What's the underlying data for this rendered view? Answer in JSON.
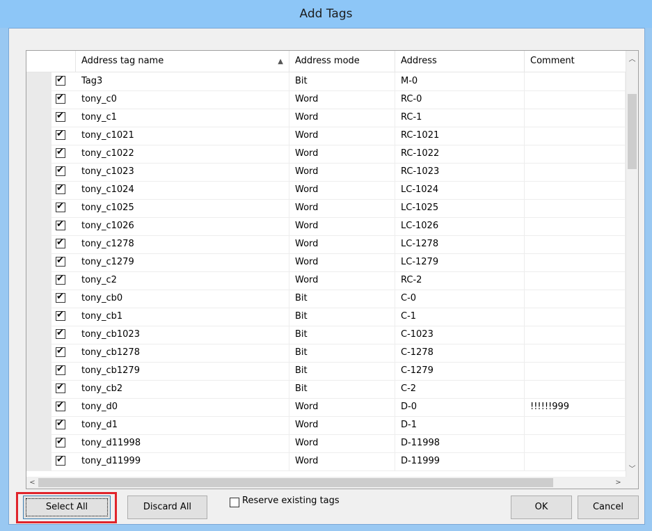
{
  "window": {
    "title": "Add Tags"
  },
  "table": {
    "columns": [
      "Address tag name",
      "Address mode",
      "Address",
      "Comment"
    ],
    "rows": [
      {
        "checked": true,
        "name": "Tag3",
        "mode": "Bit",
        "address": "M-0",
        "comment": ""
      },
      {
        "checked": true,
        "name": "tony_c0",
        "mode": "Word",
        "address": "RC-0",
        "comment": ""
      },
      {
        "checked": true,
        "name": "tony_c1",
        "mode": "Word",
        "address": "RC-1",
        "comment": ""
      },
      {
        "checked": true,
        "name": "tony_c1021",
        "mode": "Word",
        "address": "RC-1021",
        "comment": ""
      },
      {
        "checked": true,
        "name": "tony_c1022",
        "mode": "Word",
        "address": "RC-1022",
        "comment": ""
      },
      {
        "checked": true,
        "name": "tony_c1023",
        "mode": "Word",
        "address": "RC-1023",
        "comment": ""
      },
      {
        "checked": true,
        "name": "tony_c1024",
        "mode": "Word",
        "address": "LC-1024",
        "comment": ""
      },
      {
        "checked": true,
        "name": "tony_c1025",
        "mode": "Word",
        "address": "LC-1025",
        "comment": ""
      },
      {
        "checked": true,
        "name": "tony_c1026",
        "mode": "Word",
        "address": "LC-1026",
        "comment": ""
      },
      {
        "checked": true,
        "name": "tony_c1278",
        "mode": "Word",
        "address": "LC-1278",
        "comment": ""
      },
      {
        "checked": true,
        "name": "tony_c1279",
        "mode": "Word",
        "address": "LC-1279",
        "comment": ""
      },
      {
        "checked": true,
        "name": "tony_c2",
        "mode": "Word",
        "address": "RC-2",
        "comment": ""
      },
      {
        "checked": true,
        "name": "tony_cb0",
        "mode": "Bit",
        "address": "C-0",
        "comment": ""
      },
      {
        "checked": true,
        "name": "tony_cb1",
        "mode": "Bit",
        "address": "C-1",
        "comment": ""
      },
      {
        "checked": true,
        "name": "tony_cb1023",
        "mode": "Bit",
        "address": "C-1023",
        "comment": ""
      },
      {
        "checked": true,
        "name": "tony_cb1278",
        "mode": "Bit",
        "address": "C-1278",
        "comment": ""
      },
      {
        "checked": true,
        "name": "tony_cb1279",
        "mode": "Bit",
        "address": "C-1279",
        "comment": ""
      },
      {
        "checked": true,
        "name": "tony_cb2",
        "mode": "Bit",
        "address": "C-2",
        "comment": ""
      },
      {
        "checked": true,
        "name": "tony_d0",
        "mode": "Word",
        "address": "D-0",
        "comment": "!!!!!!999"
      },
      {
        "checked": true,
        "name": "tony_d1",
        "mode": "Word",
        "address": "D-1",
        "comment": ""
      },
      {
        "checked": true,
        "name": "tony_d11998",
        "mode": "Word",
        "address": "D-11998",
        "comment": ""
      },
      {
        "checked": true,
        "name": "tony_d11999",
        "mode": "Word",
        "address": "D-11999",
        "comment": ""
      }
    ]
  },
  "buttons": {
    "select_all": "Select All",
    "discard_all": "Discard All",
    "ok": "OK",
    "cancel": "Cancel"
  },
  "reserve_checkbox": {
    "label": "Reserve existing tags",
    "checked": false
  },
  "icons": {
    "sort": "sort-ascending-icon"
  },
  "colors": {
    "title_bar": "#8dc6f7",
    "highlight": "#e0242b"
  }
}
